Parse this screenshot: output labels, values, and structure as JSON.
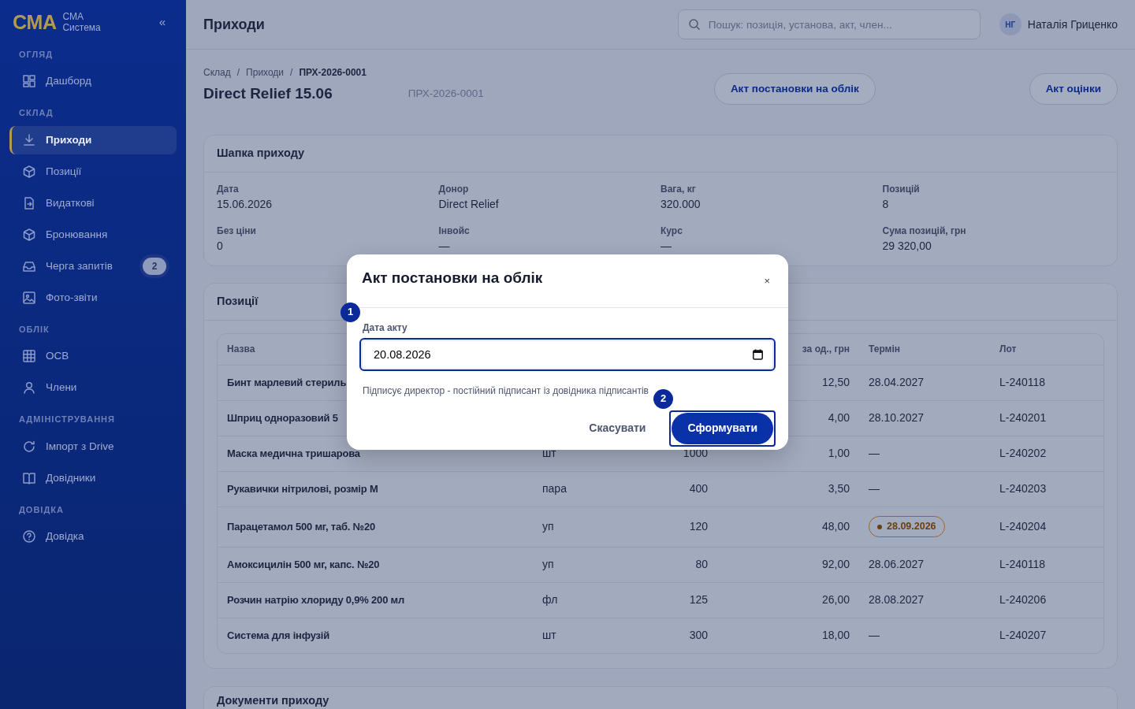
{
  "sidebar": {
    "logo": "CMA",
    "brand_lines": [
      "CMA",
      "Система"
    ],
    "collapse": "«",
    "sections": [
      {
        "title": "ОГЛЯД",
        "items": [
          {
            "label": "Дашборд",
            "selected": false
          }
        ]
      },
      {
        "title": "СКЛАД",
        "items": [
          {
            "label": "Приходи",
            "selected": true
          },
          {
            "label": "Позиції",
            "selected": false
          },
          {
            "label": "Видаткові",
            "selected": false
          },
          {
            "label": "Бронювання",
            "selected": false
          },
          {
            "label": "Черга запитів",
            "selected": false,
            "badge": "2"
          },
          {
            "label": "Фото-звіти",
            "selected": false
          }
        ]
      },
      {
        "title": "ОБЛІК",
        "items": [
          {
            "label": "ОСВ",
            "selected": false
          },
          {
            "label": "Члени",
            "selected": false
          }
        ]
      },
      {
        "title": "АДМІНІСТРУВАННЯ",
        "items": [
          {
            "label": "Імпорт з Drive",
            "selected": false
          },
          {
            "label": "Довідники",
            "selected": false
          }
        ]
      },
      {
        "title": "ДОВІДКА",
        "items": [
          {
            "label": "Довідка",
            "selected": false
          }
        ]
      }
    ]
  },
  "topbar": {
    "title": "Приходи",
    "search": {
      "placeholder": "Пошук: позиція, установа, акт, член..."
    },
    "user": {
      "initials": "НГ",
      "name": "Наталія Гриценко"
    }
  },
  "breadcrumb": {
    "items": [
      {
        "label": "Склад",
        "current": false
      },
      {
        "label": "Приходи",
        "current": false
      },
      {
        "label": "ПРХ-2026-0001",
        "current": true
      }
    ],
    "separators": [
      "/",
      "/"
    ]
  },
  "page": {
    "title": "Direct Relief 15.06",
    "code": "ПРХ-2026-0001",
    "actions": [
      "Акт постановки на облік",
      "Акт оцінки"
    ]
  },
  "header_card": {
    "title": "Шапка приходу",
    "fields": [
      {
        "label": "Дата",
        "value": "15.06.2026"
      },
      {
        "label": "Донор",
        "value": "Direct Relief"
      },
      {
        "label": "Вага, кг",
        "value": "320.000"
      },
      {
        "label": "Позицій",
        "value": "8"
      },
      {
        "label": "Без ціни",
        "value": "0"
      },
      {
        "label": "Інвойс",
        "value": "—"
      },
      {
        "label": "Курс",
        "value": "—"
      },
      {
        "label": "Сума позицій, грн",
        "value": "29 320,00"
      }
    ]
  },
  "positions": {
    "title": "Позиції",
    "table": {
      "columns": [
        "Назва",
        "",
        "",
        "за од., грн",
        "Термін",
        "Лот"
      ],
      "rows": [
        {
          "name": "Бинт марлевий стериль",
          "price": "12,50",
          "expiry": "28.04.2027",
          "expiry_warning": false,
          "lot": "L-240118"
        },
        {
          "name": "Шприц одноразовий 5",
          "price": "4,00",
          "expiry": "28.10.2027",
          "expiry_warning": false,
          "lot": "L-240201"
        },
        {
          "name": "Маска медична тришарова",
          "unit": "шт",
          "qty": "1000",
          "price": "1,00",
          "expiry": "—",
          "expiry_warning": false,
          "lot": "L-240202"
        },
        {
          "name": "Рукавички нітрилові, розмір M",
          "unit": "пара",
          "qty": "400",
          "price": "3,50",
          "expiry": "—",
          "expiry_warning": false,
          "lot": "L-240203"
        },
        {
          "name": "Парацетамол 500 мг, таб. №20",
          "unit": "уп",
          "qty": "120",
          "price": "48,00",
          "expiry": "28.09.2026",
          "expiry_warning": true,
          "lot": "L-240204"
        },
        {
          "name": "Амоксицилін 500 мг, капс. №20",
          "unit": "уп",
          "qty": "80",
          "price": "92,00",
          "expiry": "28.06.2027",
          "expiry_warning": false,
          "lot": "L-240118"
        },
        {
          "name": "Розчин натрію хлориду 0,9% 200 мл",
          "unit": "фл",
          "qty": "125",
          "price": "26,00",
          "expiry": "28.08.2027",
          "expiry_warning": false,
          "lot": "L-240206"
        },
        {
          "name": "Система для інфузій",
          "unit": "шт",
          "qty": "300",
          "price": "18,00",
          "expiry": "—",
          "expiry_warning": false,
          "lot": "L-240207"
        }
      ]
    }
  },
  "documents_card": {
    "title": "Документи приходу"
  },
  "modal": {
    "title": "Акт постановки на облік",
    "close": "×",
    "field": {
      "label": "Дата акту",
      "value": "20.08.2026",
      "focused": true,
      "step": "1"
    },
    "hint": "Підписує директор - постійний підписант із довідника підписантів",
    "cancel": "Скасувати",
    "submit": {
      "label": "Сформувати",
      "focused": true,
      "step": "2"
    }
  }
}
